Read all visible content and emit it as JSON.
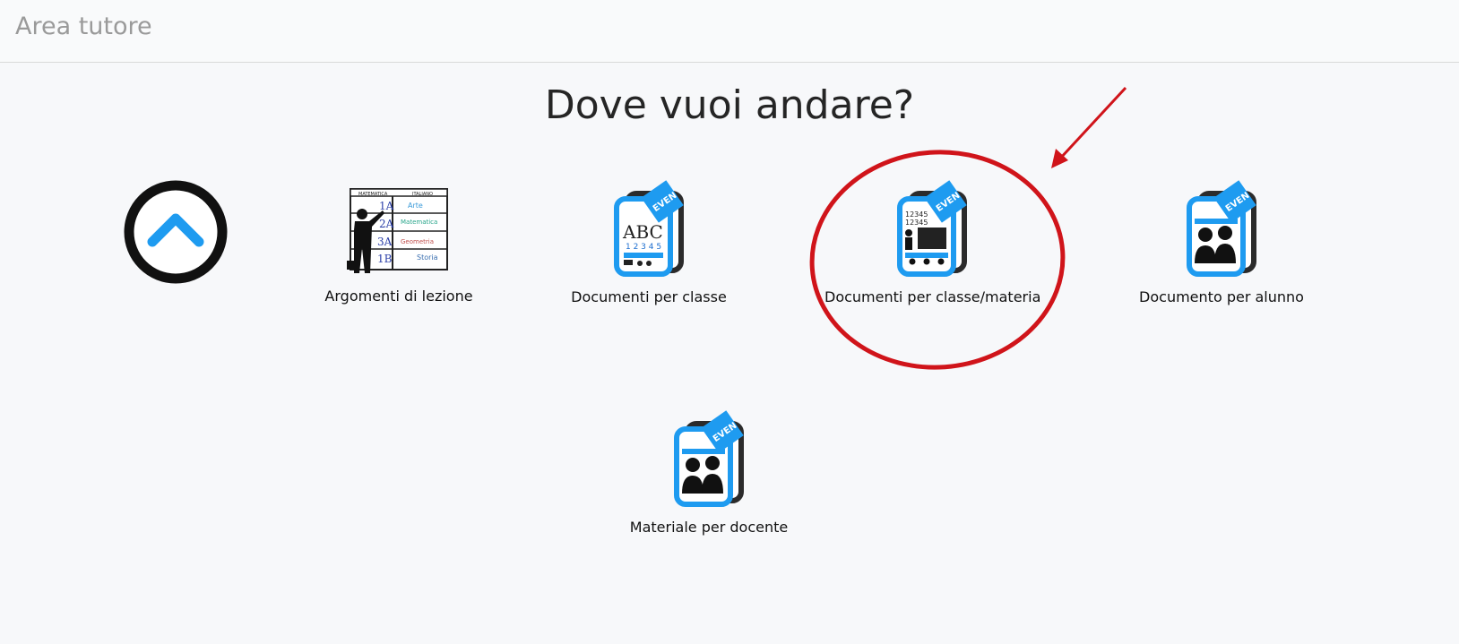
{
  "app": {
    "title": "Area tutore"
  },
  "page": {
    "heading": "Dove vuoi andare?"
  },
  "back": {
    "icon": "chevron-up-icon"
  },
  "tiles": [
    {
      "label": "Argomenti di lezione",
      "icon": "lesson-topics-board-icon"
    },
    {
      "label": "Documenti per classe",
      "icon": "class-documents-icon",
      "board_text": "ABC",
      "board_numbers": "1 2 3 4 5"
    },
    {
      "label": "Documenti per classe/materia",
      "icon": "class-subject-documents-icon",
      "board_numbers": "12345"
    },
    {
      "label": "Documento per alunno",
      "icon": "student-document-icon"
    },
    {
      "label": "Materiale per docente",
      "icon": "teacher-material-icon"
    }
  ],
  "board": {
    "headers": [
      "MATEMATICA",
      "ITALIANO"
    ],
    "classes": [
      "1A",
      "2A",
      "3A",
      "1B"
    ],
    "subjects": [
      "Arte",
      "Matematica",
      "Geometria",
      "Storia"
    ]
  },
  "tag_text": "EVEN",
  "colors": {
    "accent": "#1e9bf0",
    "annotation": "#d0141a",
    "icon_dark": "#222222"
  }
}
